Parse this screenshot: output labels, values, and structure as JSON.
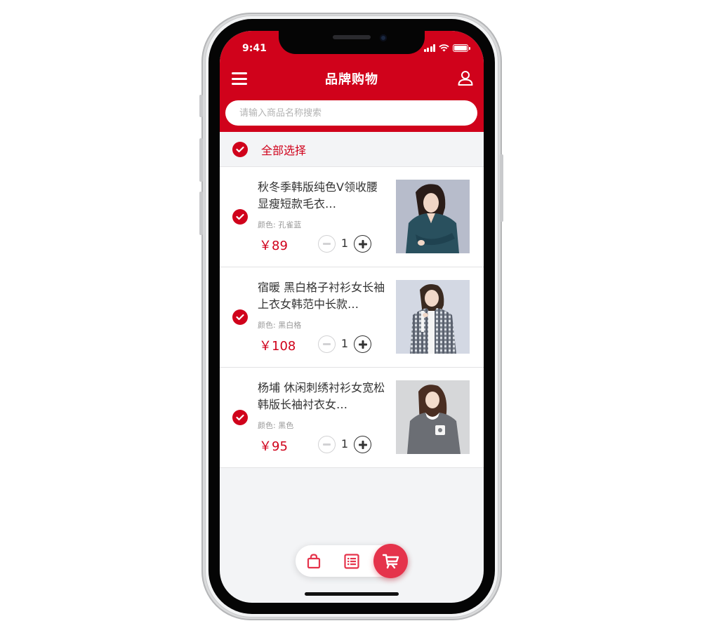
{
  "status": {
    "time": "9:41"
  },
  "header": {
    "title": "品牌购物",
    "search_placeholder": "请输入商品名称搜索"
  },
  "select_all": {
    "label": "全部选择",
    "checked": true
  },
  "colors": {
    "brand_red": "#d0021b",
    "accent_pink": "#e5334b",
    "background": "#f3f4f6"
  },
  "items": [
    {
      "title": "秋冬季韩版纯色V领收腰显瘦短款毛衣…",
      "color": "颜色: 孔雀蓝",
      "price": "￥89",
      "quantity": "1",
      "checked": true
    },
    {
      "title": "宿暖 黑白格子衬衫女长袖上衣女韩范中长款…",
      "color": "颜色: 黑白格",
      "price": "￥108",
      "quantity": "1",
      "checked": true
    },
    {
      "title": "杨埔 休闲刺绣衬衫女宽松韩版长袖衬衣女…",
      "color": "颜色: 黑色",
      "price": "￥95",
      "quantity": "1",
      "checked": true
    }
  ],
  "bottom_nav": {
    "items": [
      "shopping-bag-icon",
      "order-list-icon",
      "cart-icon"
    ],
    "active": "cart-icon"
  }
}
